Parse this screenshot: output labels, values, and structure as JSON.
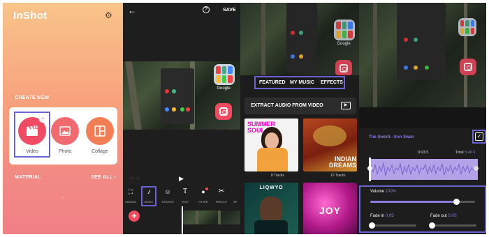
{
  "home": {
    "logo": "InShot",
    "create_new": "CREATE NEW",
    "video": "Video",
    "photo": "Photo",
    "collage": "Collage",
    "material": "MATERIAL",
    "see_all": "SEE ALL",
    "colors": {
      "video": "#f04b63",
      "photo": "#f26a6f",
      "collage": "#f37e56",
      "accent": "#6a63d6"
    }
  },
  "editor": {
    "save": "SAVE",
    "toolbar": [
      "CANVAS",
      "MUSIC",
      "STICKER",
      "TEXT",
      "FILTER",
      "PRECUT",
      "SP"
    ],
    "google_label": "Google",
    "folder_label": "Folder"
  },
  "music": {
    "tabs": [
      "FEATURED",
      "MY MUSIC",
      "EFFECTS"
    ],
    "extract": "EXTRACT AUDIO FROM VIDEO",
    "album1": "SUMMER SOUL",
    "album2": "INDIAN DREAMS",
    "album3": "LIQWYD",
    "album4": "JOY",
    "tracks1": "8 Tracks",
    "tracks2": "10 Tracks",
    "google_label": "Google"
  },
  "audio": {
    "song": "The Sword - Iron Swan",
    "time": "0:03.5",
    "total_label": "Total",
    "total": "5:46.6",
    "volume_label": "Volume",
    "volume": "100%",
    "fadein_label": "Fade in",
    "fadein": "0.0S",
    "fadeout_label": "Fade out",
    "fadeout": "0.0S",
    "volume_level": 0.82
  }
}
